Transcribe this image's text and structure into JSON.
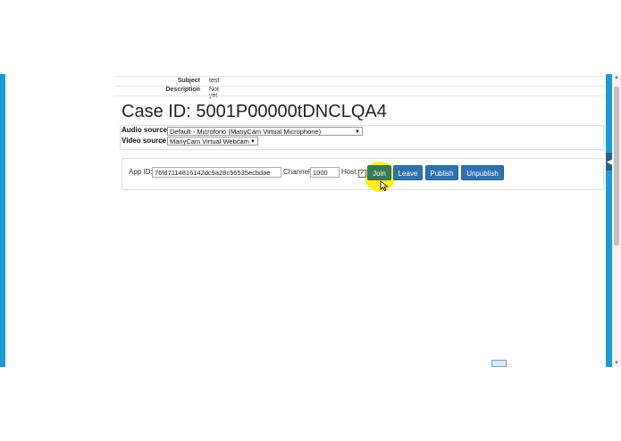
{
  "case_details": {
    "subject_label": "Subject",
    "subject_value": "test",
    "description_label": "Description",
    "description_value": "Not yet"
  },
  "case": {
    "title": "Case ID: 5001P00000tDNCLQA4"
  },
  "sources": {
    "audio_label": "Audio source:",
    "audio_value": "Default - Micrófono (ManyCam Virtual Microphone)",
    "video_label": "Video source:",
    "video_value": "ManyCam Virtual Webcam"
  },
  "controls": {
    "app_id_label": "App ID:",
    "app_id_value": "76fd7114816142dc9a28c56535ecbdae",
    "channel_label": "Channel:",
    "channel_value": "1000",
    "host_label": "Host:",
    "host_checked": true,
    "join_label": "Join",
    "leave_label": "Leave",
    "publish_label": "Publish",
    "unpublish_label": "Unpublish"
  },
  "colors": {
    "accent": "#1d9bd1",
    "button": "#2f72b1",
    "cursor_highlight": "#ffeb00"
  }
}
